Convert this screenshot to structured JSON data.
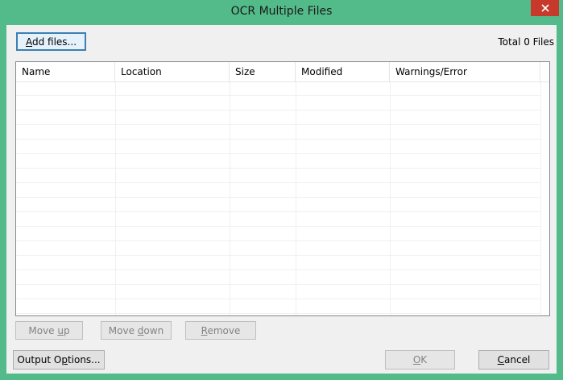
{
  "window": {
    "title": "OCR Multiple Files"
  },
  "toolbar": {
    "add_files_label": "Add files...",
    "add_files_mnemonic": "A",
    "total_label": "Total 0 Files"
  },
  "file_list": {
    "columns": [
      {
        "label": "Name"
      },
      {
        "label": "Location"
      },
      {
        "label": "Size"
      },
      {
        "label": "Modified"
      },
      {
        "label": "Warnings/Error"
      }
    ],
    "rows": []
  },
  "list_actions": {
    "move_up_label": "Move up",
    "move_down_label": "Move down",
    "remove_label": "Remove"
  },
  "footer": {
    "output_options_label": "Output Options...",
    "ok_label": "OK",
    "cancel_label": "Cancel"
  },
  "colors": {
    "frame": "#53bb8a",
    "close": "#c7392b"
  },
  "icons": {
    "close": "close-icon"
  }
}
